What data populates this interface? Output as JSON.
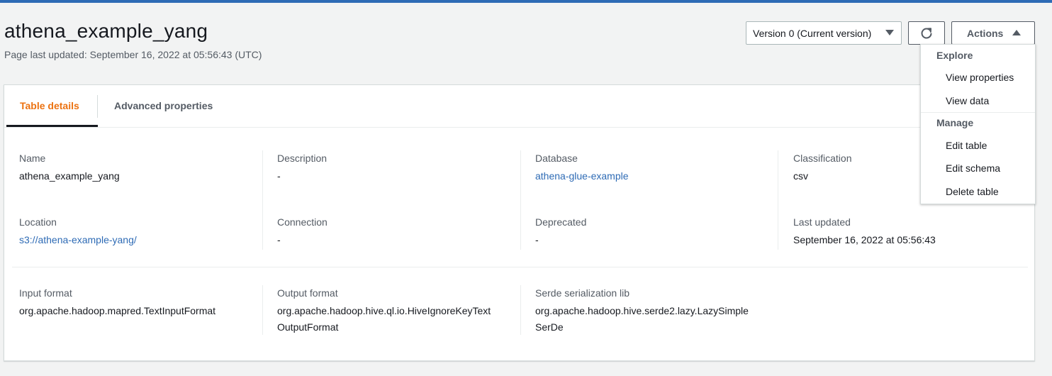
{
  "header": {
    "title": "athena_example_yang",
    "updated": "Page last updated: September 16, 2022 at 05:56:43 (UTC)"
  },
  "toolbar": {
    "version_label": "Version 0 (Current version)",
    "actions_label": "Actions"
  },
  "actions_menu": {
    "explore_label": "Explore",
    "view_properties": "View properties",
    "view_data": "View data",
    "manage_label": "Manage",
    "edit_table": "Edit table",
    "edit_schema": "Edit schema",
    "delete_table": "Delete table"
  },
  "tabs": {
    "table_details": "Table details",
    "advanced_properties": "Advanced properties"
  },
  "details": {
    "name": {
      "label": "Name",
      "value": "athena_example_yang"
    },
    "description": {
      "label": "Description",
      "value": "-"
    },
    "database": {
      "label": "Database",
      "value": "athena-glue-example"
    },
    "classification": {
      "label": "Classification",
      "value": "csv"
    },
    "location": {
      "label": "Location",
      "value": "s3://athena-example-yang/"
    },
    "connection": {
      "label": "Connection",
      "value": "-"
    },
    "deprecated": {
      "label": "Deprecated",
      "value": "-"
    },
    "last_updated": {
      "label": "Last updated",
      "value": "September 16, 2022 at 05:56:43"
    },
    "input_format": {
      "label": "Input format",
      "value": "org.apache.hadoop.mapred.TextInputFormat"
    },
    "output_format": {
      "label": "Output format",
      "value_line1": "org.apache.hadoop.hive.ql.io.HiveIgnoreKeyText",
      "value_line2": "OutputFormat"
    },
    "serde_lib": {
      "label": "Serde serialization lib",
      "value_line1": "org.apache.hadoop.hive.serde2.lazy.LazySimple",
      "value_line2": "SerDe"
    }
  },
  "colors": {
    "accent_tab": "#ec7211",
    "link": "#2e6bb5",
    "top_bar": "#2e6bb5"
  },
  "icons": {
    "refresh": "refresh-icon",
    "version_caret": "caret-down-icon",
    "actions_caret": "caret-up-icon"
  }
}
